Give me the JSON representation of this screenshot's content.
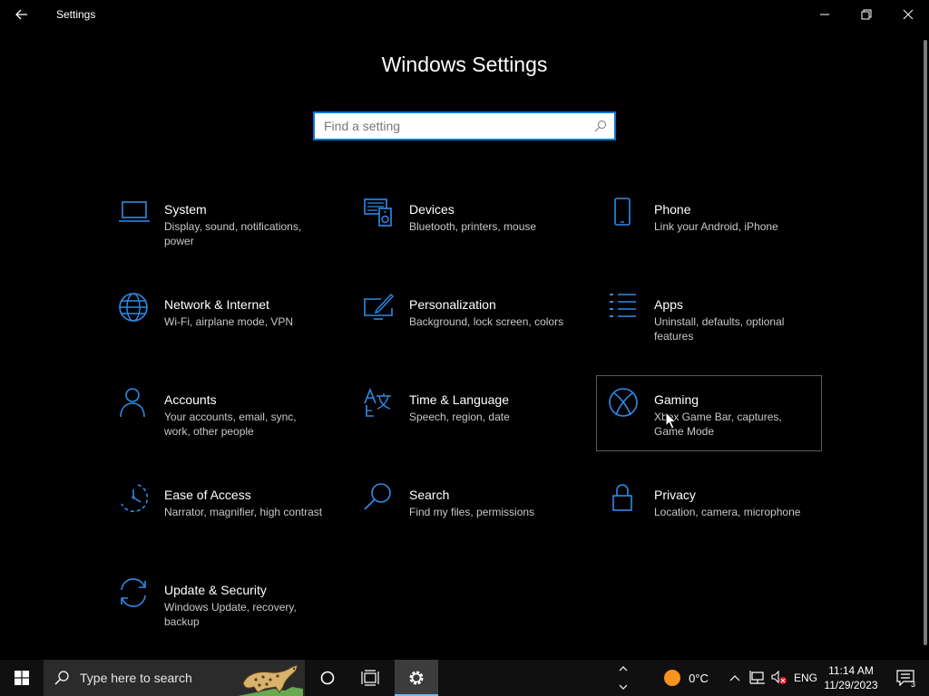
{
  "window": {
    "title": "Settings"
  },
  "header": {
    "title": "Windows Settings",
    "search_placeholder": "Find a setting"
  },
  "categories": [
    {
      "name": "System",
      "desc": "Display, sound, notifications, power",
      "icon": "laptop-icon"
    },
    {
      "name": "Devices",
      "desc": "Bluetooth, printers, mouse",
      "icon": "devices-icon"
    },
    {
      "name": "Phone",
      "desc": "Link your Android, iPhone",
      "icon": "phone-icon"
    },
    {
      "name": "Network & Internet",
      "desc": "Wi-Fi, airplane mode, VPN",
      "icon": "globe-icon"
    },
    {
      "name": "Personalization",
      "desc": "Background, lock screen, colors",
      "icon": "paintbrush-monitor-icon"
    },
    {
      "name": "Apps",
      "desc": "Uninstall, defaults, optional features",
      "icon": "apps-list-icon"
    },
    {
      "name": "Accounts",
      "desc": "Your accounts, email, sync, work, other people",
      "icon": "person-icon"
    },
    {
      "name": "Time & Language",
      "desc": "Speech, region, date",
      "icon": "time-language-icon"
    },
    {
      "name": "Gaming",
      "desc": "Xbox Game Bar, captures, Game Mode",
      "icon": "xbox-icon"
    },
    {
      "name": "Ease of Access",
      "desc": "Narrator, magnifier, high contrast",
      "icon": "ease-of-access-icon"
    },
    {
      "name": "Search",
      "desc": "Find my files, permissions",
      "icon": "magnifier-icon"
    },
    {
      "name": "Privacy",
      "desc": "Location, camera, microphone",
      "icon": "lock-icon"
    },
    {
      "name": "Update & Security",
      "desc": "Windows Update, recovery, backup",
      "icon": "sync-arrows-icon"
    }
  ],
  "taskbar": {
    "search_label": "Type here to search",
    "weather_temp": "0°C",
    "language": "ENG",
    "time": "11:14 AM",
    "date": "11/29/2023",
    "notification_count": "3"
  },
  "colors": {
    "accent": "#0078d7",
    "icon_blue": "#2e8be8",
    "background": "#000000",
    "taskbar": "#101010"
  }
}
